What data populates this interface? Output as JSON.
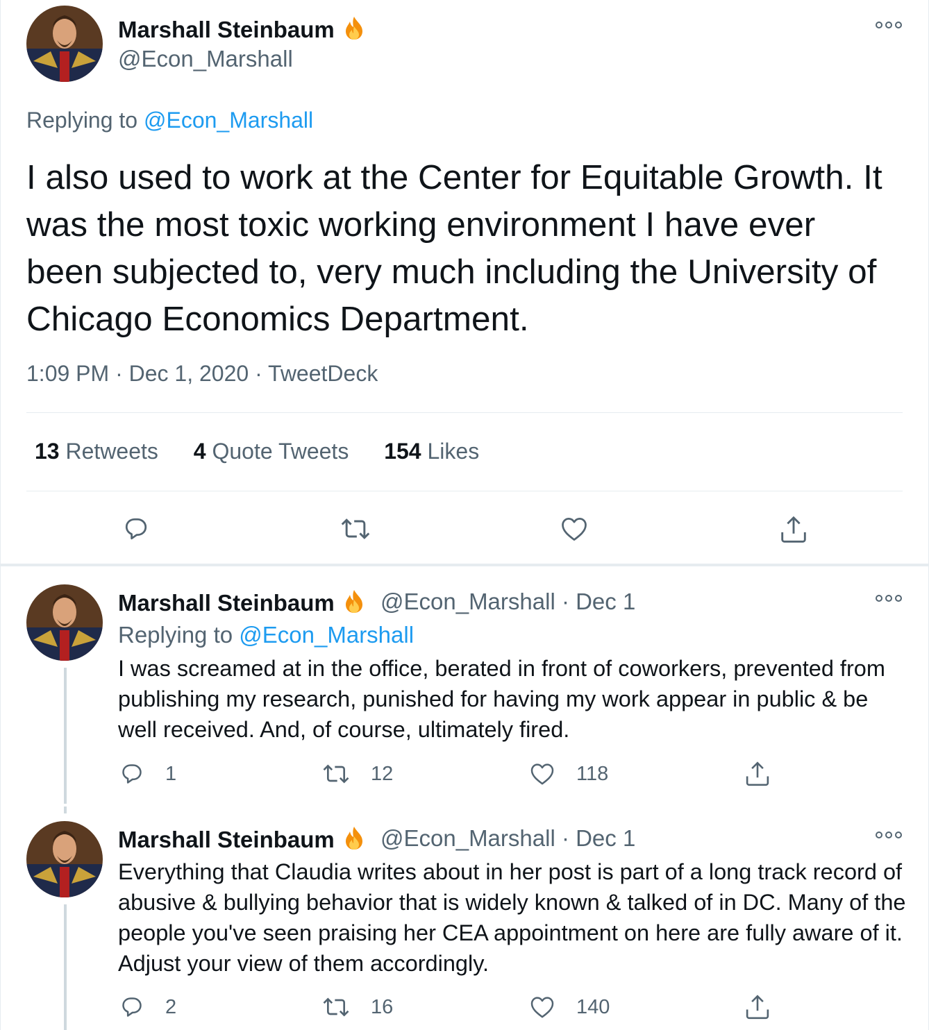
{
  "main_tweet": {
    "author_name": "Marshall Steinbaum",
    "author_handle": "@Econ_Marshall",
    "badge_icon": "fire-emoji",
    "replying_to_prefix": "Replying to",
    "replying_to_handle": "@Econ_Marshall",
    "text": "I also used to work at the Center for Equitable Growth. It was the most toxic working environment I have ever been subjected to, very much including the University of Chicago Economics Department.",
    "timestamp": "1:09 PM · Dec 1, 2020 · TweetDeck",
    "stats": {
      "retweets_count": "13",
      "retweets_label": "Retweets",
      "quotes_count": "4",
      "quotes_label": "Quote Tweets",
      "likes_count": "154",
      "likes_label": "Likes"
    }
  },
  "replies": [
    {
      "author_name": "Marshall Steinbaum",
      "author_handle_date": "@Econ_Marshall · Dec 1",
      "replying_to_prefix": "Replying to",
      "replying_to_handle": "@Econ_Marshall",
      "text": "I was screamed at in the office, berated in front of coworkers, prevented from publishing my research, punished for having my work appear in public & be well received. And, of course, ultimately fired.",
      "reply_count": "1",
      "retweet_count": "12",
      "like_count": "118"
    },
    {
      "author_name": "Marshall Steinbaum",
      "author_handle_date": "@Econ_Marshall · Dec 1",
      "text": "Everything that Claudia writes about in her post is part of a long track record of abusive & bullying behavior that is widely known & talked of in DC. Many of the people you've seen praising her CEA appointment on here are fully aware of it. Adjust your view of them accordingly.",
      "reply_count": "2",
      "retweet_count": "16",
      "like_count": "140"
    }
  ],
  "colors": {
    "text": "#0f1419",
    "secondary": "#536471",
    "link": "#1d9bf0",
    "divider": "#e6ecf0"
  }
}
